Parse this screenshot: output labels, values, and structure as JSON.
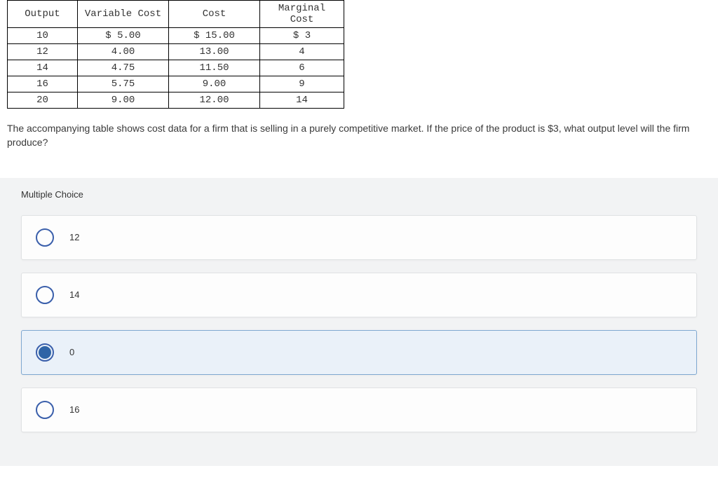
{
  "chart_data": {
    "type": "table",
    "headers": [
      "Output",
      "Variable Cost",
      "Cost",
      "Marginal Cost"
    ],
    "rows": [
      [
        "10",
        "$ 5.00",
        "$ 15.00",
        "$ 3"
      ],
      [
        "12",
        "4.00",
        "13.00",
        "4"
      ],
      [
        "14",
        "4.75",
        "11.50",
        "6"
      ],
      [
        "16",
        "5.75",
        "9.00",
        "9"
      ],
      [
        "20",
        "9.00",
        "12.00",
        "14"
      ]
    ]
  },
  "question": "The accompanying table shows cost data for a firm that is selling in a purely competitive market. If the price of the product is $3, what output level will the firm produce?",
  "mc_label": "Multiple Choice",
  "options": [
    {
      "label": "12",
      "selected": false
    },
    {
      "label": "14",
      "selected": false
    },
    {
      "label": "0",
      "selected": true
    },
    {
      "label": "16",
      "selected": false
    }
  ]
}
